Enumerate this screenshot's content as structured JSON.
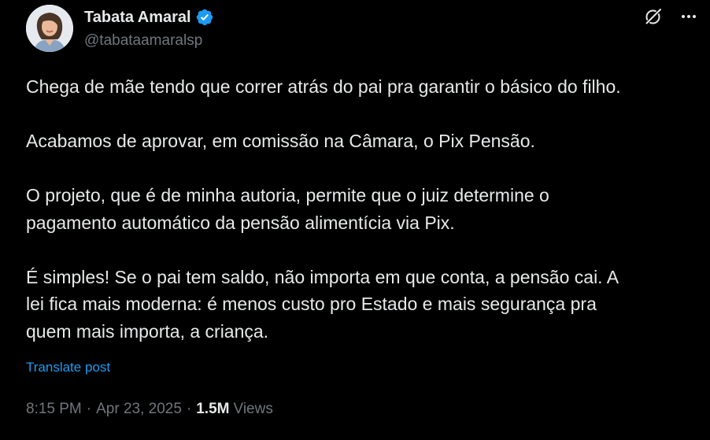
{
  "author": {
    "display_name": "Tabata Amaral",
    "handle": "@tabataamaralsp",
    "verified": true,
    "verified_icon": "verified-badge-icon",
    "avatar_icon": "avatar-photo"
  },
  "actions": {
    "grok_icon": "grok-icon",
    "more_icon": "more-horizontal-icon"
  },
  "post": {
    "paragraphs": [
      [
        "Chega de mãe tendo que correr atrás do pai pra garantir o básico do filho."
      ],
      [
        "Acabamos de aprovar, em comissão na Câmara, o Pix Pensão."
      ],
      [
        "O projeto, que é de minha autoria, permite que o juiz determine o",
        "pagamento automático da pensão alimentícia via Pix."
      ],
      [
        "É simples! Se o pai tem saldo, não importa em que conta, a pensão cai. A",
        "lei fica mais moderna: é menos custo pro Estado e mais segurança pra",
        "quem mais importa, a criança."
      ]
    ],
    "translate_label": "Translate post"
  },
  "meta": {
    "time": "8:15 PM",
    "separator": "·",
    "date": "Apr 23, 2025",
    "views_count": "1.5M",
    "views_label": "Views"
  },
  "colors": {
    "background": "#000000",
    "text_primary": "#e7e9ea",
    "text_secondary": "#71767b",
    "link": "#1d9bf0",
    "verified": "#1d9bf0"
  }
}
